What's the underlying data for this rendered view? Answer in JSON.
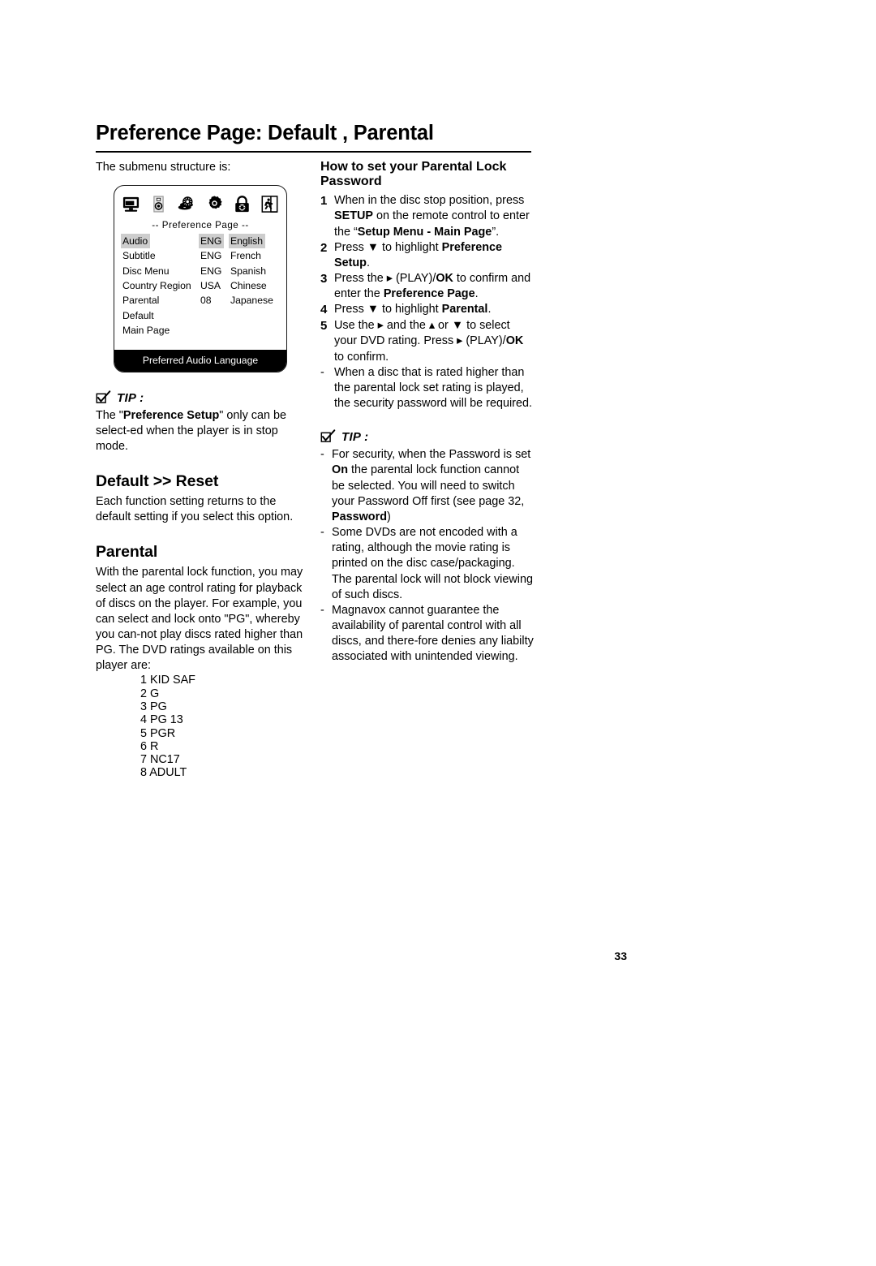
{
  "document": {
    "page_title": "Preference Page: Default , Parental",
    "page_number": "33"
  },
  "left_column": {
    "lead_text": "The submenu structure is:",
    "osd": {
      "icons": [
        "monitor-icon",
        "speaker-icon",
        "discs-icon",
        "gear-icon",
        "lock-icon",
        "exit-icon"
      ],
      "header": "--  Preference  Page  --",
      "rows": [
        {
          "label": "Audio",
          "code": "ENG",
          "language": "English",
          "label_highlight": true,
          "code_highlight": true,
          "language_highlight": true
        },
        {
          "label": "Subtitle",
          "code": "ENG",
          "language": "French",
          "label_highlight": false,
          "code_highlight": false,
          "language_highlight": false
        },
        {
          "label": "Disc Menu",
          "code": "ENG",
          "language": "Spanish",
          "label_highlight": false,
          "code_highlight": false,
          "language_highlight": false
        },
        {
          "label": "Country Region",
          "code": "USA",
          "language": "Chinese",
          "label_highlight": false,
          "code_highlight": false,
          "language_highlight": false
        },
        {
          "label": "Parental",
          "code": "08",
          "language": "Japanese",
          "label_highlight": false,
          "code_highlight": false,
          "language_highlight": false
        },
        {
          "label": "Default",
          "code": "",
          "language": "",
          "label_highlight": false,
          "code_highlight": false,
          "language_highlight": false
        },
        {
          "label": "Main Page",
          "code": "",
          "language": "",
          "label_highlight": false,
          "code_highlight": false,
          "language_highlight": false
        }
      ],
      "footer": "Preferred Audio Language",
      "highlight_color": "#cdcdcd",
      "footer_background": "#000000"
    },
    "tip": {
      "icon": "check-box-icon",
      "label": "TIP :",
      "text_part1": "The \"",
      "text_bold": "Preference Setup",
      "text_part2": "\" only can be select-ed when the player is in stop mode."
    },
    "default_reset": {
      "heading": "Default >> Reset",
      "body": "Each function setting returns to the default setting if you select this option."
    },
    "parental": {
      "heading": "Parental",
      "body": "With the parental lock function, you may select an age control rating for playback of discs on the player. For example, you can select and lock onto \"PG\", whereby you can-not play discs rated higher than PG. The DVD ratings available on this player are:",
      "ratings": [
        "1 KID SAF",
        "2 G",
        "3 PG",
        "4 PG 13",
        "5 PGR",
        "6 R",
        "7 NC17",
        "8 ADULT"
      ]
    }
  },
  "right_column": {
    "heading": "How to set your Parental Lock Password",
    "steps": [
      {
        "number": "1",
        "segments": [
          {
            "text": "When in the disc stop position, press ",
            "bold": false
          },
          {
            "text": "SETUP",
            "bold": true
          },
          {
            "text": " on the remote control to enter the “",
            "bold": false
          },
          {
            "text": "Setup Menu - Main Page",
            "bold": true
          },
          {
            "text": "”.",
            "bold": false
          }
        ]
      },
      {
        "number": "2",
        "segments": [
          {
            "text": "Press ▼  to highlight ",
            "bold": false
          },
          {
            "text": "Preference Setup",
            "bold": true
          },
          {
            "text": ".",
            "bold": false
          }
        ]
      },
      {
        "number": "3",
        "segments": [
          {
            "text": "Press the ▸ (PLAY)/",
            "bold": false
          },
          {
            "text": "OK",
            "bold": true
          },
          {
            "text": "  to confirm and enter the ",
            "bold": false
          },
          {
            "text": "Preference Page",
            "bold": true
          },
          {
            "text": ".",
            "bold": false
          }
        ]
      },
      {
        "number": "4",
        "segments": [
          {
            "text": "Press ▼  to highlight ",
            "bold": false
          },
          {
            "text": "Parental",
            "bold": true
          },
          {
            "text": ".",
            "bold": false
          }
        ]
      },
      {
        "number": "5",
        "segments": [
          {
            "text": "Use the ▸  and the ▴ or ▼  to select your DVD rating. Press ▸ (PLAY)/",
            "bold": false
          },
          {
            "text": "OK",
            "bold": true
          },
          {
            "text": " to confirm.",
            "bold": false
          }
        ]
      },
      {
        "number": "-",
        "segments": [
          {
            "text": "When a disc that is rated higher than the parental lock set rating is played, the security password will be required.",
            "bold": false
          }
        ]
      }
    ],
    "tip": {
      "icon": "check-box-icon",
      "label": "TIP :",
      "bullets": [
        {
          "mark": "-",
          "segments": [
            {
              "text": "For security, when the Password is set ",
              "bold": false
            },
            {
              "text": "On",
              "bold": true
            },
            {
              "text": " the parental lock function cannot be selected. You will need to switch your Password Off first (see page 32, ",
              "bold": false
            },
            {
              "text": "Password",
              "bold": true
            },
            {
              "text": ")",
              "bold": false
            }
          ]
        },
        {
          "mark": "-",
          "segments": [
            {
              "text": "Some DVDs are not encoded with a rating, although the movie rating is printed on the disc case/packaging. The parental lock will not block viewing of such discs.",
              "bold": false
            }
          ]
        },
        {
          "mark": "-",
          "segments": [
            {
              "text": "Magnavox cannot guarantee the availability of parental control with all discs, and there-fore denies any liabilty associated with unintended viewing.",
              "bold": false
            }
          ]
        }
      ]
    }
  }
}
